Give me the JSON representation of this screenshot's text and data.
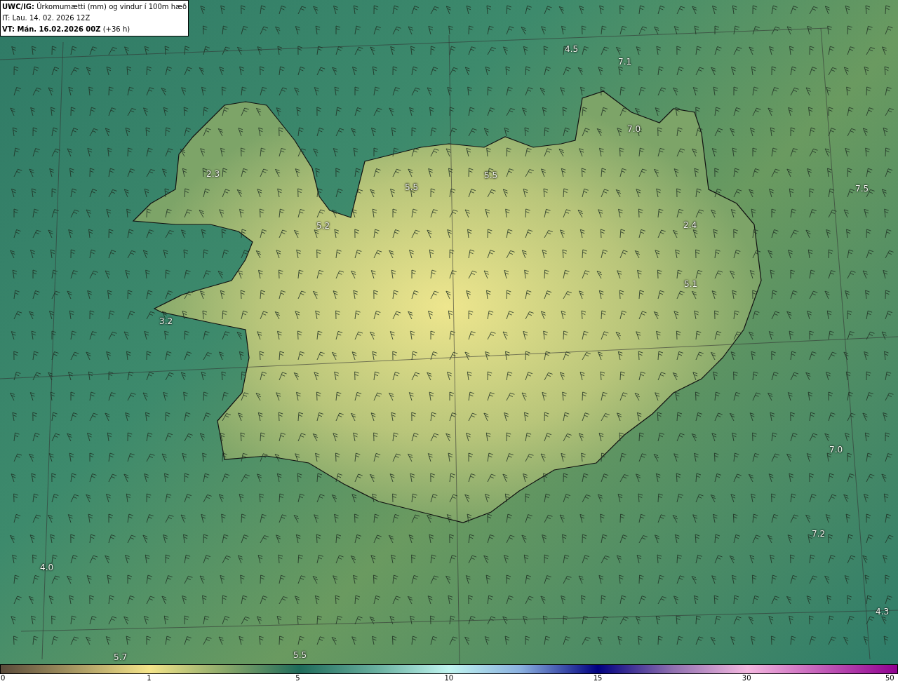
{
  "header": {
    "title": "**UWC/IG:** Úrkomumætti (mm) og vindur í 100m hæð",
    "issue_time": "IT: Lau. 14. 02. 2026 12Z",
    "valid_time": "**VT: Mán. 16.02.2026 00Z** (+36 h)"
  },
  "map_labels": [
    "4.5",
    "7.1",
    "7.0",
    "2.3",
    "5.5",
    "5.5",
    "7.5",
    "5.2",
    "2.4",
    "5.1",
    "3.2",
    "7.0",
    "7.2",
    "4.0",
    "4.3",
    "5.7",
    "5.5"
  ],
  "colorbar": {
    "ticks": [
      "0",
      "1",
      "5",
      "10",
      "15",
      "30",
      "50"
    ]
  }
}
